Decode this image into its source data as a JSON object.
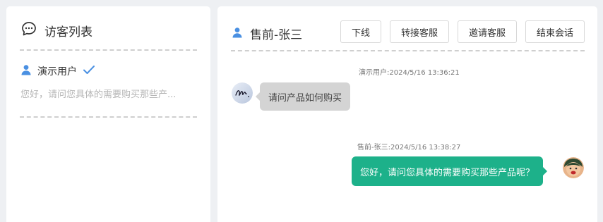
{
  "visitor_panel": {
    "title": "访客列表",
    "title_icon": "chat-bubble-icon",
    "visitors": [
      {
        "name": "演示用户",
        "user_icon": "user-icon",
        "status_icon": "checkmark-icon",
        "last_message": "您好，请问您具体的需要购买那些产..."
      }
    ]
  },
  "chat_panel": {
    "agent_name": "售前-张三",
    "agent_icon": "user-icon",
    "buttons": {
      "offline": "下线",
      "transfer": "转接客服",
      "invite": "邀请客服",
      "end": "结束会话"
    },
    "messages": [
      {
        "direction": "incoming",
        "meta": "演示用户:2024/5/16 13:36:21",
        "text": "请问产品如何购买",
        "avatar": "handwriting-avatar"
      },
      {
        "direction": "outgoing",
        "meta": "售前-张三:2024/5/16 13:38:27",
        "text": "您好，请问您具体的需要购买那些产品呢？",
        "avatar": "cartoon-avatar"
      }
    ]
  },
  "colors": {
    "accent_blue": "#4a90e2",
    "outgoing_bubble": "#1db18a",
    "incoming_bubble": "#d4d4d4",
    "page_background": "#eef0f3"
  }
}
